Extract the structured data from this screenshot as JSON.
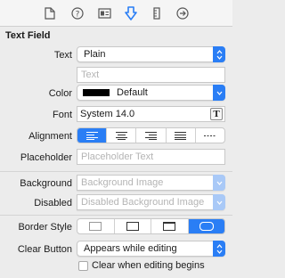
{
  "toolbar": {
    "tabs": [
      {
        "name": "file-inspector",
        "icon": "document-icon"
      },
      {
        "name": "quick-help",
        "icon": "question-icon"
      },
      {
        "name": "identity-inspector",
        "icon": "identity-card-icon"
      },
      {
        "name": "attributes-inspector",
        "icon": "attributes-down-arrow-icon",
        "selected": true
      },
      {
        "name": "size-inspector",
        "icon": "ruler-icon"
      },
      {
        "name": "connections-inspector",
        "icon": "arrow-circle-icon"
      }
    ]
  },
  "section": {
    "title": "Text Field"
  },
  "text": {
    "label": "Text",
    "value": "Plain",
    "field_placeholder": "Text"
  },
  "color": {
    "label": "Color",
    "value": "Default",
    "swatch": "#000000"
  },
  "font": {
    "label": "Font",
    "value": "System 14.0"
  },
  "alignment": {
    "label": "Alignment",
    "options": [
      "left",
      "center",
      "right",
      "justified",
      "natural"
    ],
    "selected": "left"
  },
  "placeholder": {
    "label": "Placeholder",
    "placeholder": "Placeholder Text"
  },
  "background": {
    "label": "Background",
    "placeholder": "Background Image"
  },
  "disabled": {
    "label": "Disabled",
    "placeholder": "Disabled Background Image"
  },
  "border_style": {
    "label": "Border Style",
    "options": [
      "none",
      "line",
      "bezel",
      "rounded-rect"
    ],
    "selected": "rounded-rect"
  },
  "clear_button": {
    "label": "Clear Button",
    "value": "Appears while editing"
  },
  "clear_when_editing": {
    "label": "Clear when editing begins",
    "checked": false
  },
  "colors": {
    "accent": "#2a7ef5"
  }
}
